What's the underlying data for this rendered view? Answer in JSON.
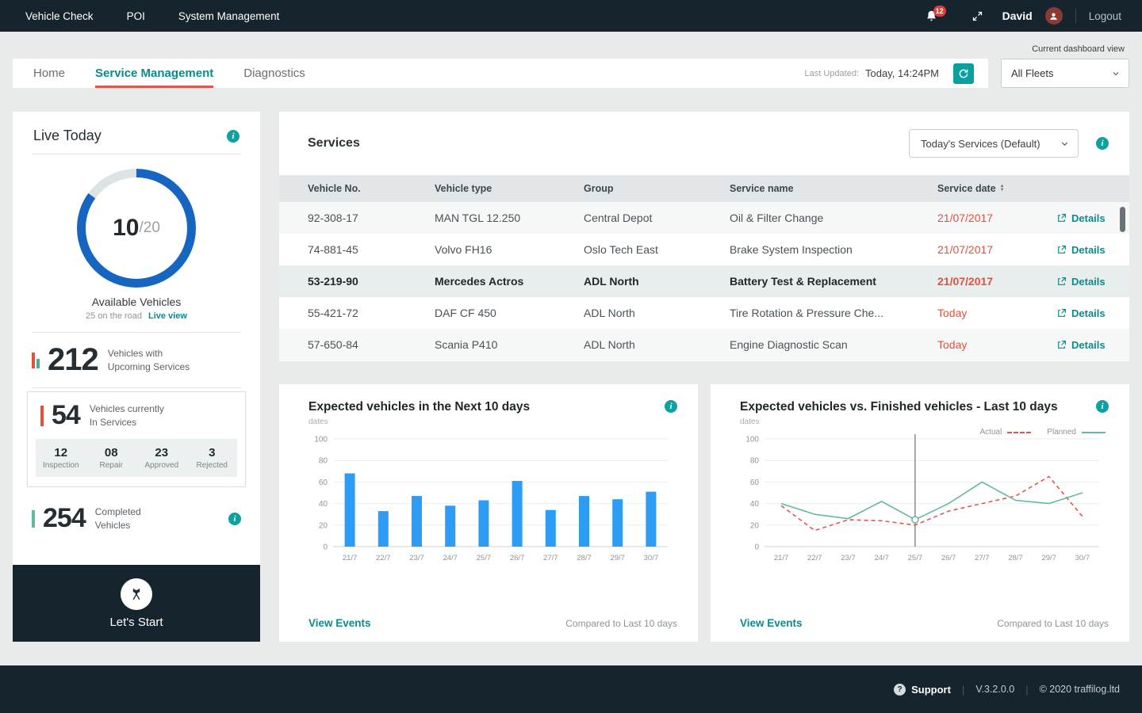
{
  "colors": {
    "accent_teal": "#0a8c8c",
    "alert_red": "#e2503d",
    "bar_blue": "#2d9cf4",
    "donut_blue": "#1665c1",
    "dark": "#15242d"
  },
  "icons": {
    "info": "i",
    "question": "?",
    "sort_up": "▲",
    "sort_down": "▼"
  },
  "navbar": {
    "items": [
      "Vehicle Check",
      "POI",
      "System Management"
    ],
    "notification_count": "12",
    "user_name": "David",
    "logout_label": "Logout"
  },
  "dashboard_view": {
    "label": "Current dashboard view",
    "selected": "All Fleets"
  },
  "tabs": {
    "items": [
      "Home",
      "Service Management",
      "Diagnostics"
    ],
    "active_index": 1,
    "last_updated_label": "Last Updated:",
    "last_updated_value": "Today, 14:24PM"
  },
  "live_today": {
    "title": "Live Today",
    "donut": {
      "value": "10",
      "total": "/20",
      "percent_filled": 85,
      "label": "Available Vehicles",
      "sub_text": "25 on the road",
      "link_label": "Live view"
    },
    "upcoming": {
      "value": "212",
      "label_line1": "Vehicles with",
      "label_line2": "Upcoming Services"
    },
    "in_service": {
      "value": "54",
      "label_line1": "Vehicles currently",
      "label_line2": "In Services",
      "breakdown": [
        {
          "value": "12",
          "label": "Inspection"
        },
        {
          "value": "08",
          "label": "Repair"
        },
        {
          "value": "23",
          "label": "Approved"
        },
        {
          "value": "3",
          "label": "Rejected"
        }
      ]
    },
    "completed": {
      "value": "254",
      "label_line1": "Completed",
      "label_line2": "Vehicles"
    },
    "start_button": "Let's Start"
  },
  "services": {
    "title": "Services",
    "filter_selected": "Today's Services (Default)",
    "columns": [
      "Vehicle No.",
      "Vehicle type",
      "Group",
      "Service name",
      "Service date"
    ],
    "details_label": "Details",
    "rows": [
      {
        "vehicle_no": "92-308-17",
        "vehicle_type": "MAN TGL 12.250",
        "group": "Central Depot",
        "service_name": "Oil & Filter Change",
        "service_date": "21/07/2017",
        "selected": false
      },
      {
        "vehicle_no": "74-881-45",
        "vehicle_type": "Volvo FH16",
        "group": "Oslo Tech East",
        "service_name": "Brake System Inspection",
        "service_date": "21/07/2017",
        "selected": false
      },
      {
        "vehicle_no": "53-219-90",
        "vehicle_type": "Mercedes Actros",
        "group": "ADL North",
        "service_name": "Battery Test & Replacement",
        "service_date": "21/07/2017",
        "selected": true
      },
      {
        "vehicle_no": "55-421-72",
        "vehicle_type": "DAF CF 450",
        "group": "ADL North",
        "service_name": "Tire Rotation & Pressure Che...",
        "service_date": "Today",
        "selected": false
      },
      {
        "vehicle_no": "57-650-84",
        "vehicle_type": "Scania P410",
        "group": "ADL North",
        "service_name": "Engine Diagnostic Scan",
        "service_date": "Today",
        "selected": false
      }
    ]
  },
  "chart_data": [
    {
      "type": "bar",
      "title": "Expected vehicles in the Next 10 days",
      "axis_label": "dates",
      "categories": [
        "21/7",
        "22/7",
        "23/7",
        "24/7",
        "25/7",
        "26/7",
        "27/7",
        "28/7",
        "29/7",
        "30/7"
      ],
      "values": [
        68,
        33,
        47,
        38,
        43,
        61,
        34,
        47,
        44,
        51
      ],
      "ylim": [
        0,
        100
      ],
      "yticks": [
        0,
        20,
        40,
        60,
        80,
        100
      ],
      "grid": true,
      "bar_color": "#2d9cf4",
      "footer_link": "View Events",
      "footer_note": "Compared to Last 10 days"
    },
    {
      "type": "line",
      "title": "Expected vehicles vs. Finished vehicles -  Last 10 days",
      "axis_label": "dates",
      "categories": [
        "21/7",
        "22/7",
        "23/7",
        "24/7",
        "25/7",
        "26/7",
        "27/7",
        "28/7",
        "29/7",
        "30/7"
      ],
      "series": [
        {
          "name": "Actual",
          "color": "#e2574d",
          "dashed": true,
          "values": [
            38,
            15,
            25,
            24,
            20,
            33,
            40,
            47,
            65,
            28
          ]
        },
        {
          "name": "Planned",
          "color": "#66b7a6",
          "dashed": false,
          "values": [
            40,
            30,
            26,
            42,
            25,
            40,
            60,
            43,
            40,
            50
          ]
        }
      ],
      "ylim": [
        0,
        100
      ],
      "yticks": [
        0,
        20,
        40,
        60,
        80,
        100
      ],
      "grid": true,
      "legend_position": "top-right",
      "highlight_index": 4,
      "footer_link": "View Events",
      "footer_note": "Compared to Last 10 days"
    }
  ],
  "footer": {
    "support_label": "Support",
    "version": "V.3.2.0.0",
    "copyright": "© 2020 traffilog.ltd"
  }
}
